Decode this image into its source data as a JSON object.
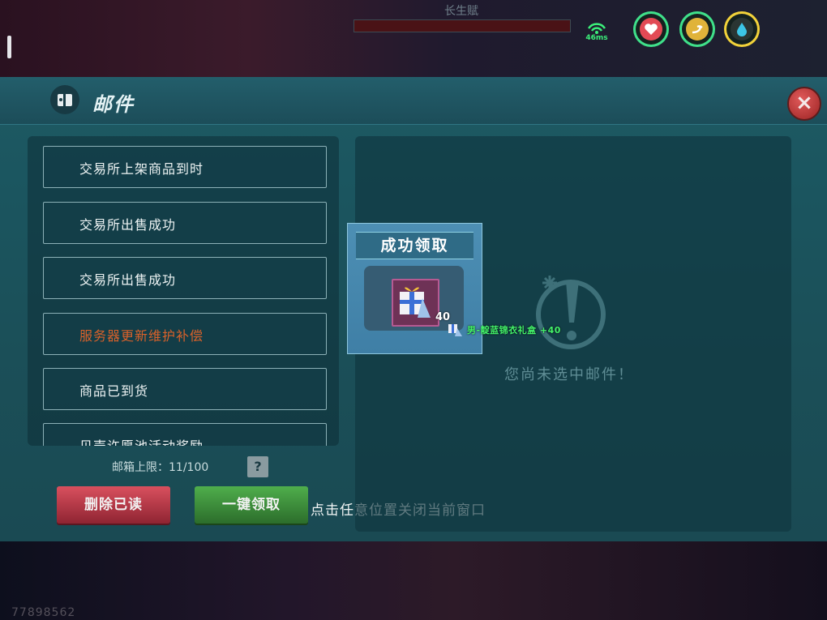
{
  "hud": {
    "boss_name": "长生赋",
    "boss_hp_fraction": 1.0,
    "ping": "46ms",
    "skills": [
      {
        "icon": "heart-icon",
        "color": "#3fe08a"
      },
      {
        "icon": "swirl-icon",
        "color": "#3fe08a"
      },
      {
        "icon": "droplet-icon",
        "color": "#f2d23a"
      }
    ],
    "player_id": "77898562"
  },
  "mail_panel": {
    "title": "邮件",
    "mail_items": [
      {
        "label": "交易所上架商品到时",
        "highlight": false
      },
      {
        "label": "交易所出售成功",
        "highlight": false
      },
      {
        "label": "交易所出售成功",
        "highlight": false
      },
      {
        "label": "服务器更新维护补偿",
        "highlight": true
      },
      {
        "label": "商品已到货",
        "highlight": false
      },
      {
        "label": "贝壳许愿池活动奖励",
        "highlight": false
      }
    ],
    "capacity_label": "邮箱上限：11/100",
    "help_label": "?",
    "delete_read_label": "删除已读",
    "claim_all_label": "一键领取",
    "close_hint": "点击任意位置关闭当前窗口",
    "empty_state_text": "您尚未选中邮件！"
  },
  "popup": {
    "title": "成功领取",
    "item_count": "40",
    "reward_text": "男-靛蓝锦衣礼盒 +40"
  },
  "colors": {
    "panel": "#1b5660",
    "highlight_text": "#d9612a",
    "reward_text": "#43f26a",
    "delete_button": "#c8404e",
    "claim_button": "#43a040"
  }
}
